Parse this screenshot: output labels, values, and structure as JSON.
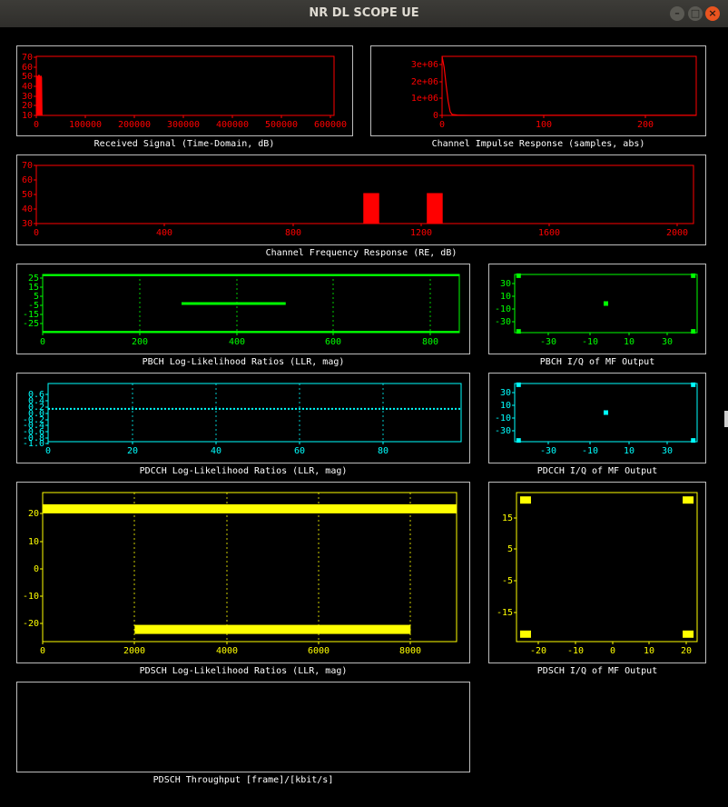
{
  "window": {
    "title": "NR DL SCOPE UE",
    "minimize_icon": "minimize-icon",
    "maximize_icon": "maximize-icon",
    "close_icon": "close-icon"
  },
  "colors": {
    "received": "#ff0000",
    "impulse": "#ff0000",
    "freq": "#ff0000",
    "pbch": "#00ff00",
    "pdcch": "#00ffff",
    "pdsch": "#ffff00"
  },
  "plots": {
    "received_signal": {
      "caption": "Received Signal (Time-Domain, dB)",
      "y_ticks": [
        "70",
        "60",
        "50",
        "40",
        "30",
        "20",
        "10"
      ],
      "x_ticks": [
        "0",
        "100000",
        "200000",
        "300000",
        "400000",
        "500000",
        "600000"
      ]
    },
    "channel_impulse": {
      "caption": "Channel Impulse Response (samples, abs)",
      "y_ticks": [
        "3e+06",
        "2e+06",
        "1e+06",
        "0"
      ],
      "x_ticks": [
        "0",
        "100",
        "200"
      ]
    },
    "channel_freq": {
      "caption": "Channel Frequency Response (RE, dB)",
      "y_ticks": [
        "70",
        "60",
        "50",
        "40",
        "30"
      ],
      "x_ticks": [
        "0",
        "400",
        "800",
        "1200",
        "1600",
        "2000"
      ]
    },
    "pbch_llr": {
      "caption": "PBCH Log-Likelihood Ratios (LLR, mag)",
      "y_ticks": [
        "25",
        "15",
        "5",
        "-5",
        "-15",
        "-25"
      ],
      "x_ticks": [
        "0",
        "200",
        "400",
        "600",
        "800"
      ]
    },
    "pbch_iq": {
      "caption": "PBCH I/Q of MF Output",
      "y_ticks": [
        "30",
        "10",
        "-10",
        "-30"
      ],
      "x_ticks": [
        "-30",
        "-10",
        "10",
        "30"
      ]
    },
    "pdcch_llr": {
      "caption": "PDCCH Log-Likelihood Ratios (LLR, mag)",
      "y_ticks": [
        "0.6",
        "0.4",
        "0.2",
        "0.0",
        "-0.2",
        "-0.4",
        "-0.6",
        "-0.8",
        "-1.0"
      ],
      "x_ticks": [
        "0",
        "20",
        "40",
        "60",
        "80"
      ]
    },
    "pdcch_iq": {
      "caption": "PDCCH I/Q of MF Output",
      "y_ticks": [
        "30",
        "10",
        "-10",
        "-30"
      ],
      "x_ticks": [
        "-30",
        "-10",
        "10",
        "30"
      ]
    },
    "pdsch_llr": {
      "caption": "PDSCH Log-Likelihood Ratios (LLR, mag)",
      "y_ticks": [
        "20",
        "10",
        "0",
        "-10",
        "-20"
      ],
      "x_ticks": [
        "0",
        "2000",
        "4000",
        "6000",
        "8000"
      ]
    },
    "pdsch_iq": {
      "caption": "PDSCH I/Q of MF Output",
      "y_ticks": [
        "15",
        "5",
        "-5",
        "-15"
      ],
      "x_ticks": [
        "-20",
        "-10",
        "0",
        "10",
        "20"
      ]
    },
    "pdsch_throughput": {
      "caption": "PDSCH Throughput [frame]/[kbit/s]"
    }
  },
  "chart_data": [
    {
      "type": "area",
      "title": "Received Signal (Time-Domain, dB)",
      "xlim": [
        0,
        620000
      ],
      "ylim": [
        5,
        72
      ],
      "series": [
        {
          "x": [
            0,
            1000,
            2000,
            3000,
            4000,
            5000,
            6000,
            7000,
            8000,
            9000,
            10000,
            11000,
            12000
          ],
          "y": [
            5,
            48,
            50,
            47,
            49,
            51,
            48,
            50,
            49,
            47,
            50,
            48,
            5
          ]
        }
      ]
    },
    {
      "type": "line",
      "title": "Channel Impulse Response (samples, abs)",
      "xlim": [
        0,
        250
      ],
      "ylim": [
        0,
        3300000
      ],
      "series": [
        {
          "x": [
            0,
            2,
            4,
            6,
            8,
            10,
            15,
            20,
            30,
            250
          ],
          "y": [
            3300000,
            2700000,
            1700000,
            800000,
            200000,
            50000,
            20000,
            15000,
            10000,
            5000
          ]
        }
      ]
    },
    {
      "type": "bar",
      "title": "Channel Frequency Response (RE, dB)",
      "xlim": [
        0,
        2070
      ],
      "ylim": [
        30,
        72
      ],
      "series": [
        {
          "x": [
            1030,
            1080
          ],
          "y": [
            52,
            52
          ]
        },
        {
          "x": [
            1230,
            1280
          ],
          "y": [
            52,
            52
          ]
        }
      ]
    },
    {
      "type": "scatter",
      "title": "PBCH Log-Likelihood Ratios (LLR, mag)",
      "xlim": [
        0,
        864
      ],
      "ylim": [
        -30,
        30
      ],
      "series": [
        {
          "x": [
            288,
            504
          ],
          "y": [
            0,
            0
          ],
          "note_range": true
        },
        {
          "baseline_upper": 29,
          "baseline_lower": -29
        }
      ]
    },
    {
      "type": "scatter",
      "title": "PBCH I/Q of MF Output",
      "xlim": [
        -47,
        47
      ],
      "ylim": [
        -47,
        47
      ],
      "series": [
        {
          "x": [
            -45,
            45,
            45,
            -45,
            0
          ],
          "y": [
            45,
            45,
            -45,
            -45,
            0
          ]
        }
      ]
    },
    {
      "type": "scatter",
      "title": "PDCCH Log-Likelihood Ratios (LLR, mag)",
      "xlim": [
        0,
        99
      ],
      "ylim": [
        -1.1,
        0.85
      ],
      "series": [
        {
          "x_range": [
            0,
            99
          ],
          "y": 0.0
        }
      ]
    },
    {
      "type": "scatter",
      "title": "PDCCH I/Q of MF Output",
      "xlim": [
        -47,
        47
      ],
      "ylim": [
        -47,
        47
      ],
      "series": [
        {
          "x": [
            -45,
            45,
            45,
            -45,
            0
          ],
          "y": [
            45,
            45,
            -45,
            -45,
            0
          ]
        }
      ]
    },
    {
      "type": "scatter",
      "title": "PDSCH Log-Likelihood Ratios (LLR, mag)",
      "xlim": [
        0,
        9000
      ],
      "ylim": [
        -27,
        28
      ],
      "series": [
        {
          "name": "upper",
          "x_range": [
            0,
            9000
          ],
          "y": 22
        },
        {
          "name": "lower",
          "x_range": [
            2000,
            8000
          ],
          "y": -22.5
        }
      ]
    },
    {
      "type": "scatter",
      "title": "PDSCH I/Q of MF Output",
      "xlim": [
        -25,
        25
      ],
      "ylim": [
        -25,
        25
      ],
      "series": [
        {
          "x": [
            -22.5,
            22.5,
            22.5,
            -22.5
          ],
          "y": [
            22.5,
            22.5,
            -22.5,
            -22.5
          ]
        }
      ]
    }
  ]
}
